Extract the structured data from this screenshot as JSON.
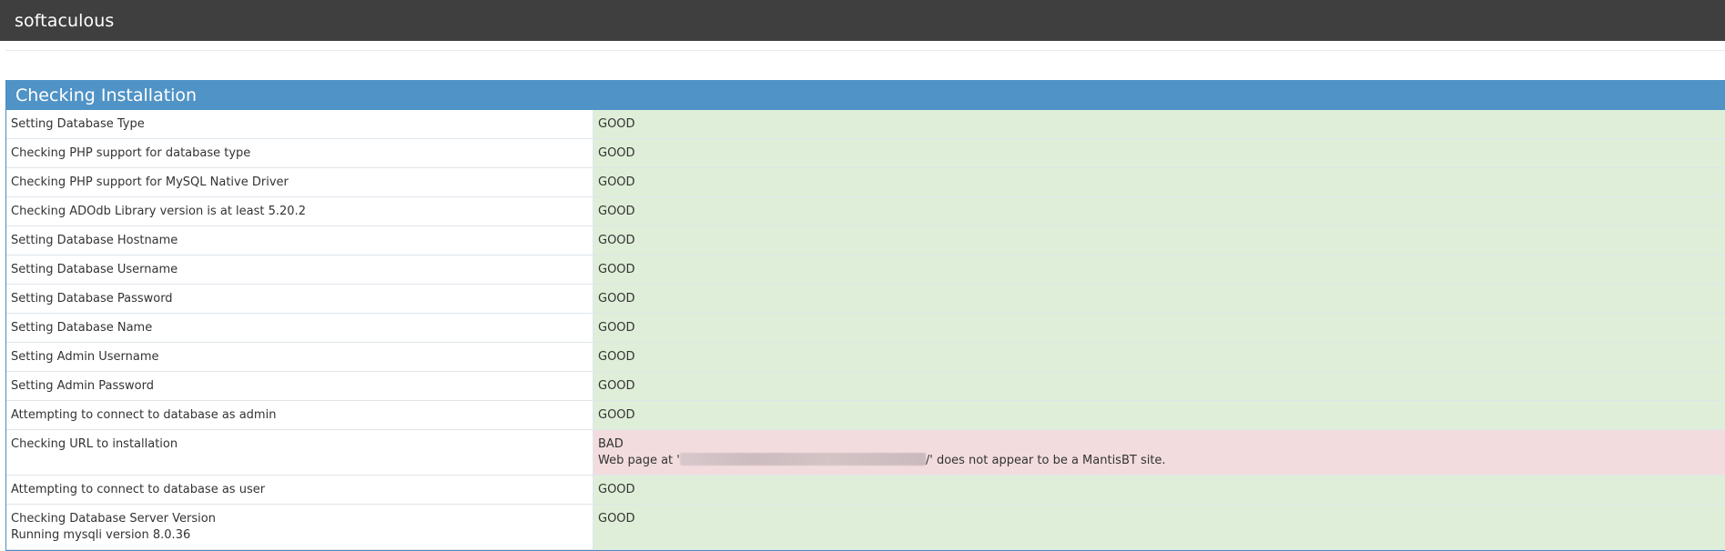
{
  "app": {
    "brand": "softaculous"
  },
  "panel": {
    "title": "Checking Installation"
  },
  "checks": [
    {
      "label": "Setting Database Type",
      "status": "GOOD"
    },
    {
      "label": "Checking PHP support for database type",
      "status": "GOOD"
    },
    {
      "label": "Checking PHP support for MySQL Native Driver",
      "status": "GOOD"
    },
    {
      "label": "Checking ADOdb Library version is at least 5.20.2",
      "status": "GOOD"
    },
    {
      "label": "Setting Database Hostname",
      "status": "GOOD"
    },
    {
      "label": "Setting Database Username",
      "status": "GOOD"
    },
    {
      "label": "Setting Database Password",
      "status": "GOOD"
    },
    {
      "label": "Setting Database Name",
      "status": "GOOD"
    },
    {
      "label": "Setting Admin Username",
      "status": "GOOD"
    },
    {
      "label": "Setting Admin Password",
      "status": "GOOD"
    },
    {
      "label": "Attempting to connect to database as admin",
      "status": "GOOD"
    },
    {
      "label": "Checking URL to installation",
      "status": "BAD",
      "message_prefix": "Web page at '",
      "message_suffix": "/' does not appear to be a MantisBT site."
    },
    {
      "label": "Attempting to connect to database as user",
      "status": "GOOD"
    },
    {
      "label": "Checking Database Server Version",
      "sublabel": "Running mysqli version 8.0.36",
      "status": "GOOD"
    }
  ],
  "colors": {
    "topbar": "#3f3f3f",
    "header": "#5093c6",
    "good_bg": "#dfeed8",
    "bad_bg": "#f2dcde"
  }
}
